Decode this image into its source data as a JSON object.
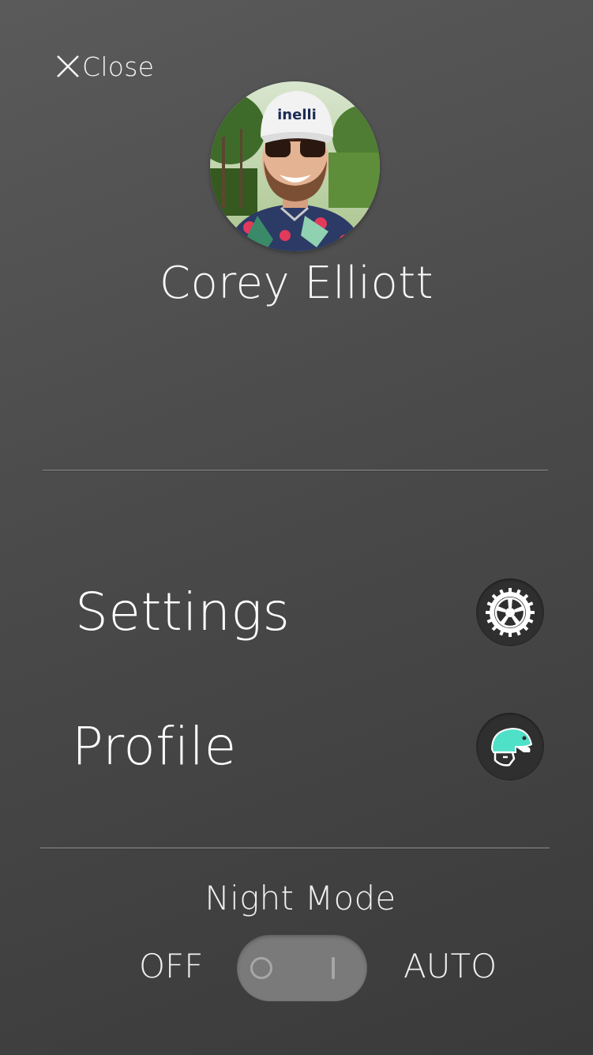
{
  "header": {
    "close_label": "Close"
  },
  "user": {
    "name": "Corey Elliott",
    "avatar_cap_text": "inelli"
  },
  "menu": {
    "items": [
      {
        "label": "Settings",
        "icon": "chainring-gear-icon"
      },
      {
        "label": "Profile",
        "icon": "cycling-helmet-icon"
      }
    ]
  },
  "night_mode": {
    "title": "Night Mode",
    "option_off": "OFF",
    "option_auto": "AUTO",
    "selected": "OFF"
  },
  "colors": {
    "helmet_accent": "#4fe0c8",
    "toggle_track": "#7a7a7a",
    "icon_bg": "#2f2f2f"
  }
}
